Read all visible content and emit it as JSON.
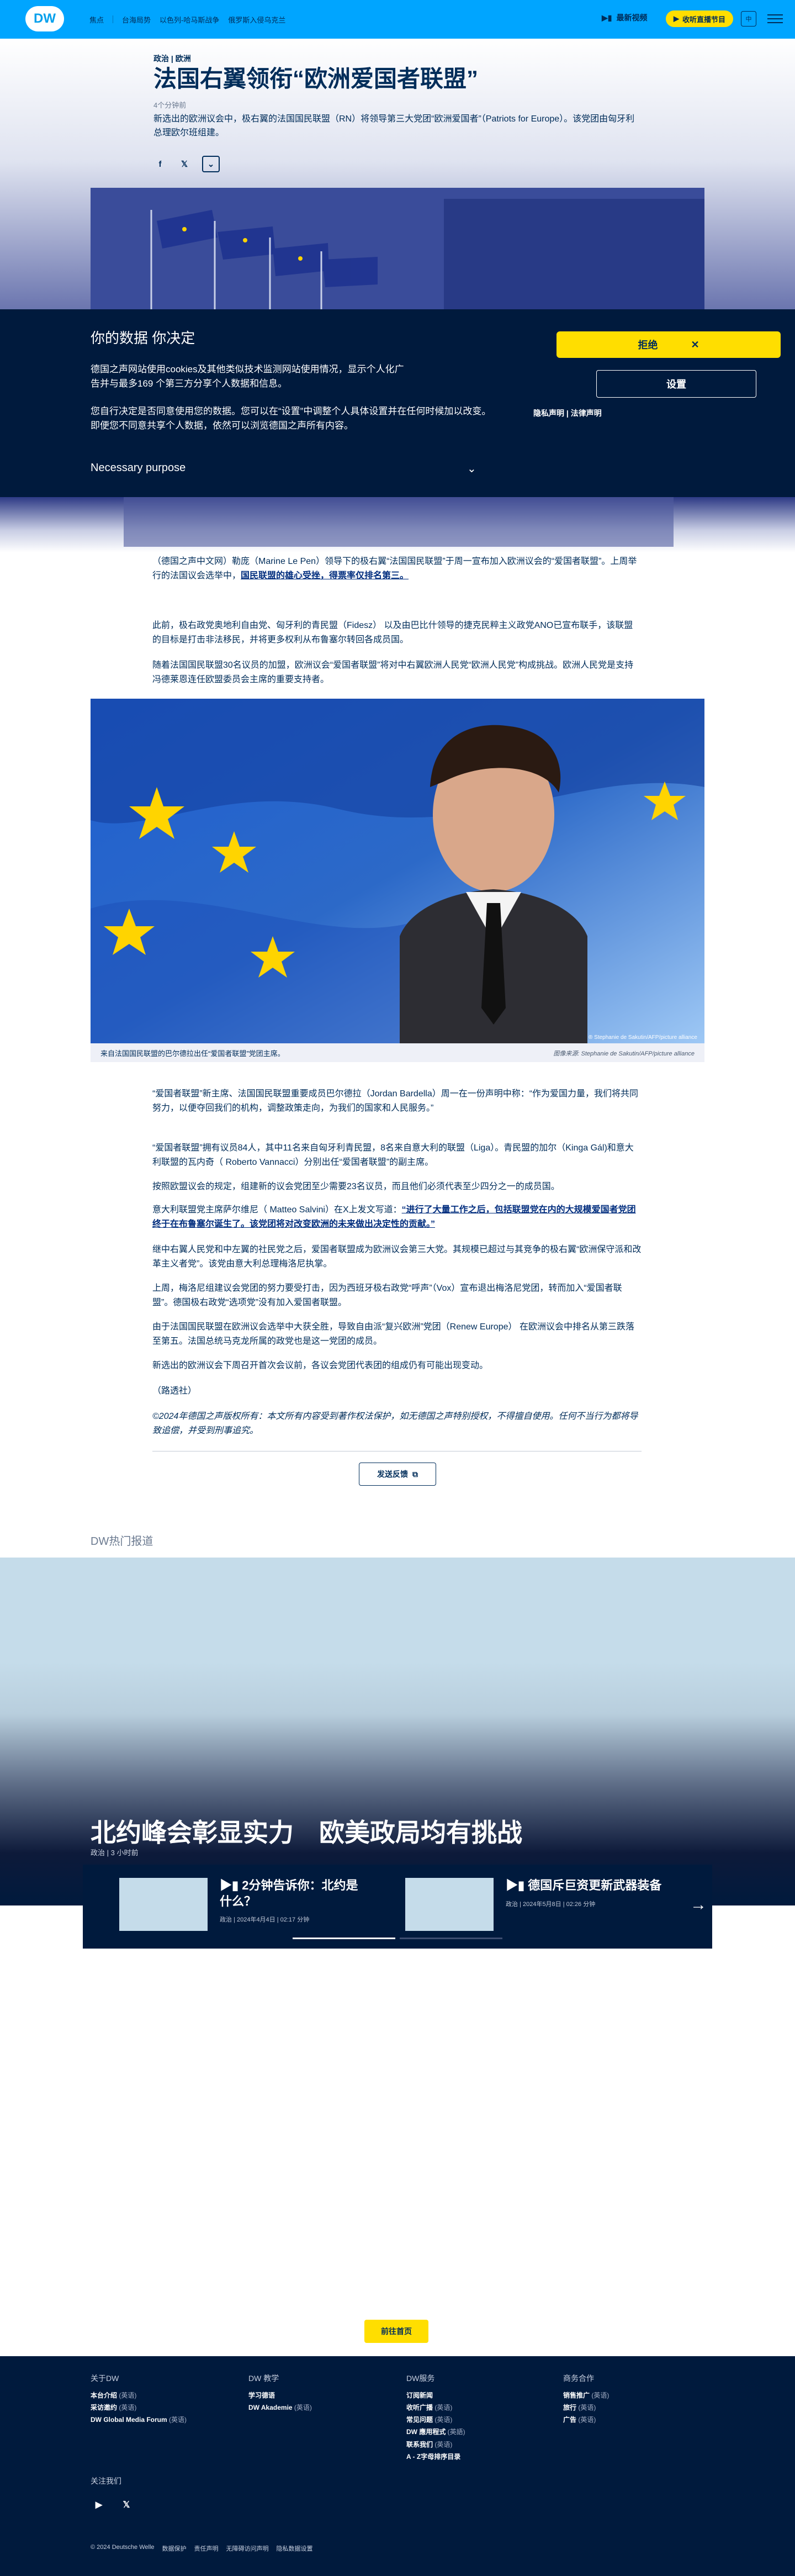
{
  "header": {
    "logo": "DW",
    "nav": [
      "焦点",
      "台海局势",
      "以色列-哈马斯战争",
      "俄罗斯入侵乌克兰"
    ],
    "live": "最新视频",
    "radio": "收听直播节目",
    "lang": "中"
  },
  "article": {
    "kicker": "政治 | 欧洲",
    "title": "法国右翼领衔“欧洲爱国者联盟”",
    "readtime": "4个分钟前",
    "lead": "新选出的欧洲议会中，极右翼的法国国民联盟（RN）将领导第三大党团“欧洲爱国者”（Patriots for Europe）。该党团由匈牙利总理欧尔班组建。"
  },
  "cookie": {
    "title": "你的数据 你决定",
    "p1": "德国之声网站使用cookies及其他类似技术监测网站使用情况，显示个人化广告并与最多169 个第三方分享个人数据和信息。",
    "p2": "您自行决定是否同意使用您的数据。您可以在“设置”中调整个人具体设置并在任何时候加以改变。即便您不同意共享个人数据，依然可以浏览德国之声所有内容。",
    "purpose": "Necessary purpose",
    "reject": "拒绝",
    "settings": "设置",
    "privacy": "隐私声明",
    "legal": "法律声明"
  },
  "body": {
    "p1a": "（德国之声中文网）勒庞（Marine Le Pen）领导下的极右翼“法国国民联盟”于周一宣布加入欧洲议会的“爱国者联盟”。上周举行的法国议会选举中，",
    "p1link": "国民联盟的雄心受挫，得票率仅排名第三。",
    "p2": "此前，极右政党奥地利自由党、匈牙利的青民盟（Fidesz） 以及由巴比什领导的捷克民粹主义政党ANO已宣布联手，该联盟的目标是打击非法移民，并将更多权利从布鲁塞尔转回各成员国。",
    "p3": "随着法国国民联盟30名议员的加盟，欧洲议会“爱国者联盟”将对中右翼欧洲人民党“欧洲人民党”构成挑战。欧洲人民党是支持冯德莱恩连任欧盟委员会主席的重要支持者。",
    "p4": "“爱国者联盟”新主席、法国国民联盟重要成员巴尔德拉（Jordan Bardella）周一在一份声明中称：“作为爱国力量，我们将共同努力，以便夺回我们的机构，调整政策走向，为我们的国家和人民服务。”",
    "p5": "“爱国者联盟”拥有议员84人，其中11名来自匈牙利青民盟，8名来自意大利的联盟（Liga）。青民盟的加尔（Kinga Gál)和意大利联盟的瓦内奇（ Roberto Vannacci）分别出任“爱国者联盟”的副主席。",
    "p6": "按照欧盟议会的规定，组建新的议会党团至少需要23名议员，而且他们必须代表至少四分之一的成员国。",
    "p7a": "意大利联盟党主席萨尔维尼（ Matteo Salvini）在X上发文写道：",
    "p7link": "“进行了大量工作之后，包括联盟党在内的大规模爱国者党团终于在布鲁塞尔诞生了。该党团将对改变欧洲的未来做出决定性的贡献。”",
    "p8": "继中右翼人民党和中左翼的社民党之后，爱国者联盟成为欧洲议会第三大党。其规模已超过与其竞争的极右翼“欧洲保守派和改革主义者党”。该党由意大利总理梅洛尼执掌。",
    "p9": "上周，梅洛尼组建议会党团的努力要受打击，因为西班牙极右政党“呼声”（Vox）宣布退出梅洛尼党团，转而加入“爱国者联盟”。德国极右政党“选项党”没有加入爱国者联盟。",
    "p10": "由于法国国民联盟在欧洲议会选举中大获全胜，导致自由派“复兴欧洲”党团（Renew Europe） 在欧洲议会中排名从第三跌落至第五。法国总统马克龙所属的政党也是这一党团的成员。",
    "p11": "新选出的欧洲议会下周召开首次会议前，各议会党团代表团的组成仍有可能出现变动。",
    "p12": "（路透社）",
    "p13": "©2024年德国之声版权所有：本文所有内容受到著作权法保护，如无德国之声特别授权，不得擅自使用。任何不当行为都将导致追偿，并受到刑事追究。",
    "send": "发送反馈"
  },
  "photo": {
    "caption": "来自法国国民联盟的巴尔德拉出任“爱国者联盟”党团主席。",
    "credit_overlay": "® Stephanie de Sakutin/AFP/picture alliance",
    "credit": "图像来源: Stephanie de Sakutin/AFP/picture alliance"
  },
  "hot": {
    "label": "DW热门报道",
    "title": "北约峰会彰显实力　欧美政局均有挑战",
    "meta": "政治 | 3 小时前",
    "items": [
      {
        "title": "2分钟告诉你：北约是什么？",
        "meta": "政治 | 2024年4月4日 | 02:17 分钟"
      },
      {
        "title": "德国斥巨资更新武器装备",
        "meta": "政治 | 2024年5月8日 | 02:26 分钟"
      }
    ]
  },
  "home": "前往首页",
  "footer": {
    "cols": [
      {
        "h": "关于DW",
        "items": [
          [
            "本台介绍",
            "(英语)"
          ],
          [
            "采访邀约",
            "(英语)"
          ],
          [
            "DW Global Media Forum",
            "(英语)"
          ]
        ]
      },
      {
        "h": "DW 教学",
        "items": [
          [
            "学习德语",
            ""
          ],
          [
            "DW Akademie",
            "(英语)"
          ]
        ]
      },
      {
        "h": "DW服务",
        "items": [
          [
            "订阅新闻",
            ""
          ],
          [
            "收听广播",
            "(英语)"
          ],
          [
            "常见问题",
            "(英语)"
          ],
          [
            "DW 應用程式",
            "(英語)"
          ],
          [
            "联系我们",
            "(英语)"
          ],
          [
            "A - Z字母排序目录",
            ""
          ]
        ]
      },
      {
        "h": "商务合作",
        "items": [
          [
            "销售推广",
            "(英语)"
          ],
          [
            "旅行",
            "(英语)"
          ],
          [
            "广告",
            "(英语)"
          ]
        ]
      }
    ],
    "follow": "关注我们",
    "bottom": [
      "© 2024 Deutsche Welle",
      "数据保护",
      "责任声明",
      "无障碍访问声明",
      "隐私数据设置"
    ]
  }
}
